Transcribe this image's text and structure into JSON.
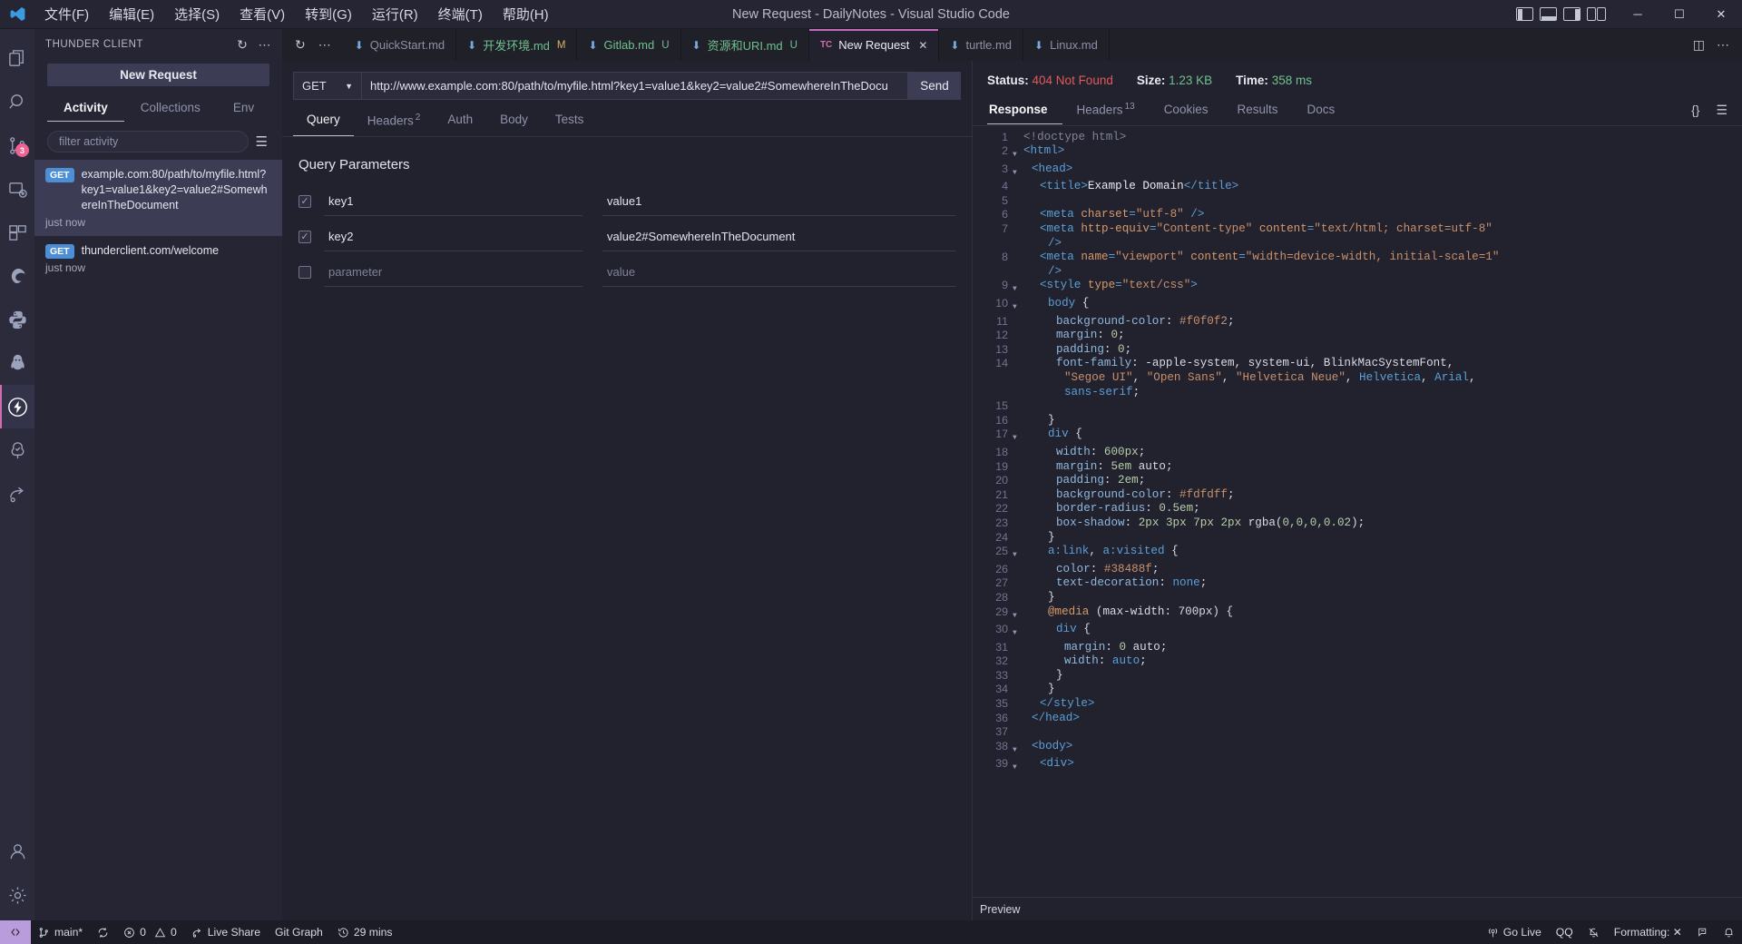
{
  "titlebar": {
    "window_title": "New Request - DailyNotes - Visual Studio Code",
    "menus": [
      {
        "label": "文件(F)",
        "name": "menu-file"
      },
      {
        "label": "编辑(E)",
        "name": "menu-edit"
      },
      {
        "label": "选择(S)",
        "name": "menu-selection"
      },
      {
        "label": "查看(V)",
        "name": "menu-view"
      },
      {
        "label": "转到(G)",
        "name": "menu-go"
      },
      {
        "label": "运行(R)",
        "name": "menu-run"
      },
      {
        "label": "终端(T)",
        "name": "menu-terminal"
      },
      {
        "label": "帮助(H)",
        "name": "menu-help"
      }
    ],
    "window_controls": {
      "minimize": "─",
      "maximize": "☐",
      "close": "✕"
    }
  },
  "activitybar": {
    "items": [
      {
        "name": "explorer-icon",
        "badge": ""
      },
      {
        "name": "search-icon",
        "badge": ""
      },
      {
        "name": "source-control-icon",
        "badge": "3"
      },
      {
        "name": "run-debug-icon",
        "badge": ""
      },
      {
        "name": "extensions-icon",
        "badge": ""
      },
      {
        "name": "edge-tools-icon",
        "badge": ""
      },
      {
        "name": "python-icon",
        "badge": ""
      },
      {
        "name": "qq-icon",
        "badge": ""
      },
      {
        "name": "thunder-client-icon",
        "badge": ""
      },
      {
        "name": "todo-tree-icon",
        "badge": ""
      },
      {
        "name": "share-icon",
        "badge": ""
      }
    ],
    "bottom": [
      {
        "name": "accounts-icon"
      },
      {
        "name": "settings-gear-icon"
      }
    ]
  },
  "sidebar": {
    "title": "THUNDER CLIENT",
    "actions": [
      {
        "name": "refresh-icon",
        "glyph": "↻"
      },
      {
        "name": "more-actions-icon",
        "glyph": "⋯"
      }
    ],
    "new_request_label": "New Request",
    "tabs": [
      {
        "label": "Activity",
        "name": "sidebar-tab-activity",
        "active": true
      },
      {
        "label": "Collections",
        "name": "sidebar-tab-collections",
        "active": false
      },
      {
        "label": "Env",
        "name": "sidebar-tab-env",
        "active": false
      }
    ],
    "filter_placeholder": "filter activity",
    "filter_value": "",
    "activity_items": [
      {
        "method": "GET",
        "url": "example.com:80/path/to/myfile.html?key1=value1&key2=value2#SomewhereInTheDocument",
        "time": "just now",
        "selected": true
      },
      {
        "method": "GET",
        "url": "thunderclient.com/welcome",
        "time": "just now",
        "selected": false
      }
    ]
  },
  "tabbar": {
    "left_actions": [
      {
        "name": "reload-icon",
        "glyph": "↻"
      },
      {
        "name": "more-icon",
        "glyph": "⋯"
      }
    ],
    "tabs": [
      {
        "label": "QuickStart.md",
        "icon": "markdown-icon",
        "badge": "",
        "active": false,
        "modified": false
      },
      {
        "label": "开发环境.md",
        "icon": "markdown-icon",
        "badge": "M",
        "badge_type": "m",
        "active": false,
        "modified": true
      },
      {
        "label": "Gitlab.md",
        "icon": "markdown-icon",
        "badge": "U",
        "badge_type": "u",
        "active": false,
        "modified": true
      },
      {
        "label": "资源和URI.md",
        "icon": "markdown-icon",
        "badge": "U",
        "badge_type": "u",
        "active": false,
        "modified": true
      },
      {
        "label": "New Request",
        "icon": "thunder-client-icon",
        "badge": "",
        "active": true,
        "modified": false
      },
      {
        "label": "turtle.md",
        "icon": "markdown-icon",
        "badge": "",
        "active": false,
        "modified": false
      },
      {
        "label": "Linux.md",
        "icon": "markdown-icon",
        "badge": "",
        "active": false,
        "modified": false
      }
    ],
    "right_actions": [
      {
        "name": "split-editor-icon",
        "glyph": "◫"
      },
      {
        "name": "more-actions-icon",
        "glyph": "⋯"
      }
    ]
  },
  "request": {
    "method": "GET",
    "url": "http://www.example.com:80/path/to/myfile.html?key1=value1&key2=value2#SomewhereInTheDocu",
    "send_label": "Send",
    "tabs": [
      {
        "label": "Query",
        "badge": "",
        "active": true
      },
      {
        "label": "Headers",
        "badge": "2",
        "active": false
      },
      {
        "label": "Auth",
        "badge": "",
        "active": false
      },
      {
        "label": "Body",
        "badge": "",
        "active": false
      },
      {
        "label": "Tests",
        "badge": "",
        "active": false
      }
    ],
    "query_title": "Query Parameters",
    "params": [
      {
        "checked": true,
        "key": "key1",
        "value": "value1",
        "placeholder": false
      },
      {
        "checked": true,
        "key": "key2",
        "value": "value2#SomewhereInTheDocument",
        "placeholder": false
      },
      {
        "checked": false,
        "key": "parameter",
        "value": "value",
        "placeholder": true
      }
    ]
  },
  "response": {
    "status_label": "Status:",
    "status_value": "404 Not Found",
    "size_label": "Size:",
    "size_value": "1.23 KB",
    "time_label": "Time:",
    "time_value": "358 ms",
    "tabs": [
      {
        "label": "Response",
        "badge": "",
        "active": true
      },
      {
        "label": "Headers",
        "badge": "13",
        "active": false
      },
      {
        "label": "Cookies",
        "badge": "",
        "active": false
      },
      {
        "label": "Results",
        "badge": "",
        "active": false
      },
      {
        "label": "Docs",
        "badge": "",
        "active": false
      }
    ],
    "right_actions": [
      {
        "name": "format-json-icon",
        "glyph": "{}"
      },
      {
        "name": "response-menu-icon",
        "glyph": "☰"
      }
    ],
    "preview_label": "Preview",
    "code_lines": [
      {
        "n": "1",
        "fold": false,
        "indent": 1,
        "html": "<span class=\"c-com\">&lt;!doctype html&gt;</span>"
      },
      {
        "n": "2",
        "fold": true,
        "indent": 1,
        "html": "<span class=\"c-tag\">&lt;html&gt;</span>"
      },
      {
        "n": "3",
        "fold": true,
        "indent": 2,
        "html": "<span class=\"c-tag\">&lt;head&gt;</span>"
      },
      {
        "n": "4",
        "fold": false,
        "indent": 3,
        "html": "<span class=\"c-tag\">&lt;title&gt;</span><span class=\"c-txt\">Example Domain</span><span class=\"c-tag\">&lt;/title&gt;</span>"
      },
      {
        "n": "5",
        "fold": false,
        "indent": 1,
        "html": ""
      },
      {
        "n": "6",
        "fold": false,
        "indent": 3,
        "html": "<span class=\"c-tag\">&lt;meta </span><span class=\"c-attr\">charset</span><span class=\"c-tag\">=</span><span class=\"c-str\">\"utf-8\"</span><span class=\"c-tag\"> /&gt;</span>"
      },
      {
        "n": "7",
        "fold": false,
        "indent": 3,
        "html": "<span class=\"c-tag\">&lt;meta </span><span class=\"c-attr\">http-equiv</span><span class=\"c-tag\">=</span><span class=\"c-str\">\"Content-type\"</span><span class=\"c-attr\"> content</span><span class=\"c-tag\">=</span><span class=\"c-str\">\"text/html; charset=utf-8\"</span>"
      },
      {
        "n": "",
        "fold": false,
        "indent": 4,
        "html": "<span class=\"c-tag\">/&gt;</span>"
      },
      {
        "n": "8",
        "fold": false,
        "indent": 3,
        "html": "<span class=\"c-tag\">&lt;meta </span><span class=\"c-attr\">name</span><span class=\"c-tag\">=</span><span class=\"c-str\">\"viewport\"</span><span class=\"c-attr\"> content</span><span class=\"c-tag\">=</span><span class=\"c-str\">\"width=device-width, initial-scale=1\"</span>"
      },
      {
        "n": "",
        "fold": false,
        "indent": 4,
        "html": "<span class=\"c-tag\">/&gt;</span>"
      },
      {
        "n": "9",
        "fold": true,
        "indent": 3,
        "html": "<span class=\"c-tag\">&lt;style </span><span class=\"c-attr\">type</span><span class=\"c-tag\">=</span><span class=\"c-str\">\"text/css\"</span><span class=\"c-tag\">&gt;</span>"
      },
      {
        "n": "10",
        "fold": true,
        "indent": 4,
        "html": "<span class=\"c-sel\">body</span><span class=\"c-plain\"> {</span>"
      },
      {
        "n": "11",
        "fold": false,
        "indent": 5,
        "html": "<span class=\"c-prop\">background-color</span><span class=\"c-plain\">: </span><span class=\"c-val\">#f0f0f2</span><span class=\"c-plain\">;</span>"
      },
      {
        "n": "12",
        "fold": false,
        "indent": 5,
        "html": "<span class=\"c-prop\">margin</span><span class=\"c-plain\">: </span><span class=\"c-num\">0</span><span class=\"c-plain\">;</span>"
      },
      {
        "n": "13",
        "fold": false,
        "indent": 5,
        "html": "<span class=\"c-prop\">padding</span><span class=\"c-plain\">: </span><span class=\"c-num\">0</span><span class=\"c-plain\">;</span>"
      },
      {
        "n": "14",
        "fold": false,
        "indent": 5,
        "html": "<span class=\"c-prop\">font-family</span><span class=\"c-plain\">: -apple-system, system-ui, BlinkMacSystemFont,</span>"
      },
      {
        "n": "",
        "fold": false,
        "indent": 6,
        "html": "<span class=\"c-val\">\"Segoe UI\"</span><span class=\"c-plain\">, </span><span class=\"c-val\">\"Open Sans\"</span><span class=\"c-plain\">, </span><span class=\"c-val\">\"Helvetica Neue\"</span><span class=\"c-plain\">, </span><span class=\"c-sel\">Helvetica</span><span class=\"c-plain\">, </span><span class=\"c-sel\">Arial</span><span class=\"c-plain\">,</span>"
      },
      {
        "n": "",
        "fold": false,
        "indent": 6,
        "html": "<span class=\"c-sel\">sans-serif</span><span class=\"c-plain\">;</span>"
      },
      {
        "n": "15",
        "fold": false,
        "indent": 1,
        "html": ""
      },
      {
        "n": "16",
        "fold": false,
        "indent": 4,
        "html": "<span class=\"c-plain\">}</span>"
      },
      {
        "n": "17",
        "fold": true,
        "indent": 4,
        "html": "<span class=\"c-sel\">div</span><span class=\"c-plain\"> {</span>"
      },
      {
        "n": "18",
        "fold": false,
        "indent": 5,
        "html": "<span class=\"c-prop\">width</span><span class=\"c-plain\">: </span><span class=\"c-num\">600px</span><span class=\"c-plain\">;</span>"
      },
      {
        "n": "19",
        "fold": false,
        "indent": 5,
        "html": "<span class=\"c-prop\">margin</span><span class=\"c-plain\">: </span><span class=\"c-num\">5em</span><span class=\"c-plain\"> auto;</span>"
      },
      {
        "n": "20",
        "fold": false,
        "indent": 5,
        "html": "<span class=\"c-prop\">padding</span><span class=\"c-plain\">: </span><span class=\"c-num\">2em</span><span class=\"c-plain\">;</span>"
      },
      {
        "n": "21",
        "fold": false,
        "indent": 5,
        "html": "<span class=\"c-prop\">background-color</span><span class=\"c-plain\">: </span><span class=\"c-val\">#fdfdff</span><span class=\"c-plain\">;</span>"
      },
      {
        "n": "22",
        "fold": false,
        "indent": 5,
        "html": "<span class=\"c-prop\">border-radius</span><span class=\"c-plain\">: </span><span class=\"c-num\">0.5em</span><span class=\"c-plain\">;</span>"
      },
      {
        "n": "23",
        "fold": false,
        "indent": 5,
        "html": "<span class=\"c-prop\">box-shadow</span><span class=\"c-plain\">: </span><span class=\"c-num\">2px</span><span class=\"c-plain\"> </span><span class=\"c-num\">3px</span><span class=\"c-plain\"> </span><span class=\"c-num\">7px</span><span class=\"c-plain\"> </span><span class=\"c-num\">2px</span><span class=\"c-plain\"> rgba(</span><span class=\"c-num\">0,0,0,0.02</span><span class=\"c-plain\">);</span>"
      },
      {
        "n": "24",
        "fold": false,
        "indent": 4,
        "html": "<span class=\"c-plain\">}</span>"
      },
      {
        "n": "25",
        "fold": true,
        "indent": 4,
        "html": "<span class=\"c-sel\">a:link</span><span class=\"c-plain\">, </span><span class=\"c-sel\">a:visited</span><span class=\"c-plain\"> {</span>"
      },
      {
        "n": "26",
        "fold": false,
        "indent": 5,
        "html": "<span class=\"c-prop\">color</span><span class=\"c-plain\">: </span><span class=\"c-val\">#38488f</span><span class=\"c-plain\">;</span>"
      },
      {
        "n": "27",
        "fold": false,
        "indent": 5,
        "html": "<span class=\"c-prop\">text-decoration</span><span class=\"c-plain\">: </span><span class=\"c-sel\">none</span><span class=\"c-plain\">;</span>"
      },
      {
        "n": "28",
        "fold": false,
        "indent": 4,
        "html": "<span class=\"c-plain\">}</span>"
      },
      {
        "n": "29",
        "fold": true,
        "indent": 4,
        "html": "<span class=\"c-attr\">@media</span><span class=\"c-plain\"> (max-width: 700px) {</span>"
      },
      {
        "n": "30",
        "fold": true,
        "indent": 5,
        "html": "<span class=\"c-sel\">div</span><span class=\"c-plain\"> {</span>"
      },
      {
        "n": "31",
        "fold": false,
        "indent": 6,
        "html": "<span class=\"c-prop\">margin</span><span class=\"c-plain\">: </span><span class=\"c-num\">0</span><span class=\"c-plain\"> auto;</span>"
      },
      {
        "n": "32",
        "fold": false,
        "indent": 6,
        "html": "<span class=\"c-prop\">width</span><span class=\"c-plain\">: </span><span class=\"c-sel\">auto</span><span class=\"c-plain\">;</span>"
      },
      {
        "n": "33",
        "fold": false,
        "indent": 5,
        "html": "<span class=\"c-plain\">}</span>"
      },
      {
        "n": "34",
        "fold": false,
        "indent": 4,
        "html": "<span class=\"c-plain\">}</span>"
      },
      {
        "n": "35",
        "fold": false,
        "indent": 3,
        "html": "<span class=\"c-tag\">&lt;/style&gt;</span>"
      },
      {
        "n": "36",
        "fold": false,
        "indent": 2,
        "html": "<span class=\"c-tag\">&lt;/head&gt;</span>"
      },
      {
        "n": "37",
        "fold": false,
        "indent": 1,
        "html": ""
      },
      {
        "n": "38",
        "fold": true,
        "indent": 2,
        "html": "<span class=\"c-tag\">&lt;body&gt;</span>"
      },
      {
        "n": "39",
        "fold": true,
        "indent": 3,
        "html": "<span class=\"c-tag\">&lt;div&gt;</span>"
      }
    ]
  },
  "statusbar": {
    "remote_icon": "remote-window-icon",
    "left": [
      {
        "name": "branch-status",
        "icon": "source-control-icon",
        "label": "main*"
      },
      {
        "name": "sync-status",
        "icon": "sync-icon",
        "label": ""
      },
      {
        "name": "problems-status",
        "icon": "error-warning-icon",
        "label": "0  0",
        "errors": "0",
        "warnings": "0"
      },
      {
        "name": "live-share-status",
        "icon": "live-share-icon",
        "label": "Live Share"
      },
      {
        "name": "git-graph-status",
        "icon": "",
        "label": "Git Graph"
      },
      {
        "name": "wakatime-status",
        "icon": "clock-icon",
        "label": "29 mins"
      }
    ],
    "right": [
      {
        "name": "go-live-status",
        "icon": "broadcast-icon",
        "label": "Go Live"
      },
      {
        "name": "qq-status",
        "icon": "",
        "label": "QQ"
      },
      {
        "name": "bell-slash-status",
        "icon": "bell-slash-icon",
        "label": ""
      },
      {
        "name": "formatting-status",
        "icon": "",
        "label": "Formatting: ✕"
      },
      {
        "name": "feedback-status",
        "icon": "feedback-icon",
        "label": ""
      },
      {
        "name": "notifications-status",
        "icon": "bell-icon",
        "label": ""
      }
    ]
  },
  "colors": {
    "accent_pink": "#d36bb0",
    "status_error": "#e05a5a",
    "status_ok": "#6fc18e",
    "method_get": "#4d8fd6",
    "remote_bg": "#b89cdc"
  }
}
